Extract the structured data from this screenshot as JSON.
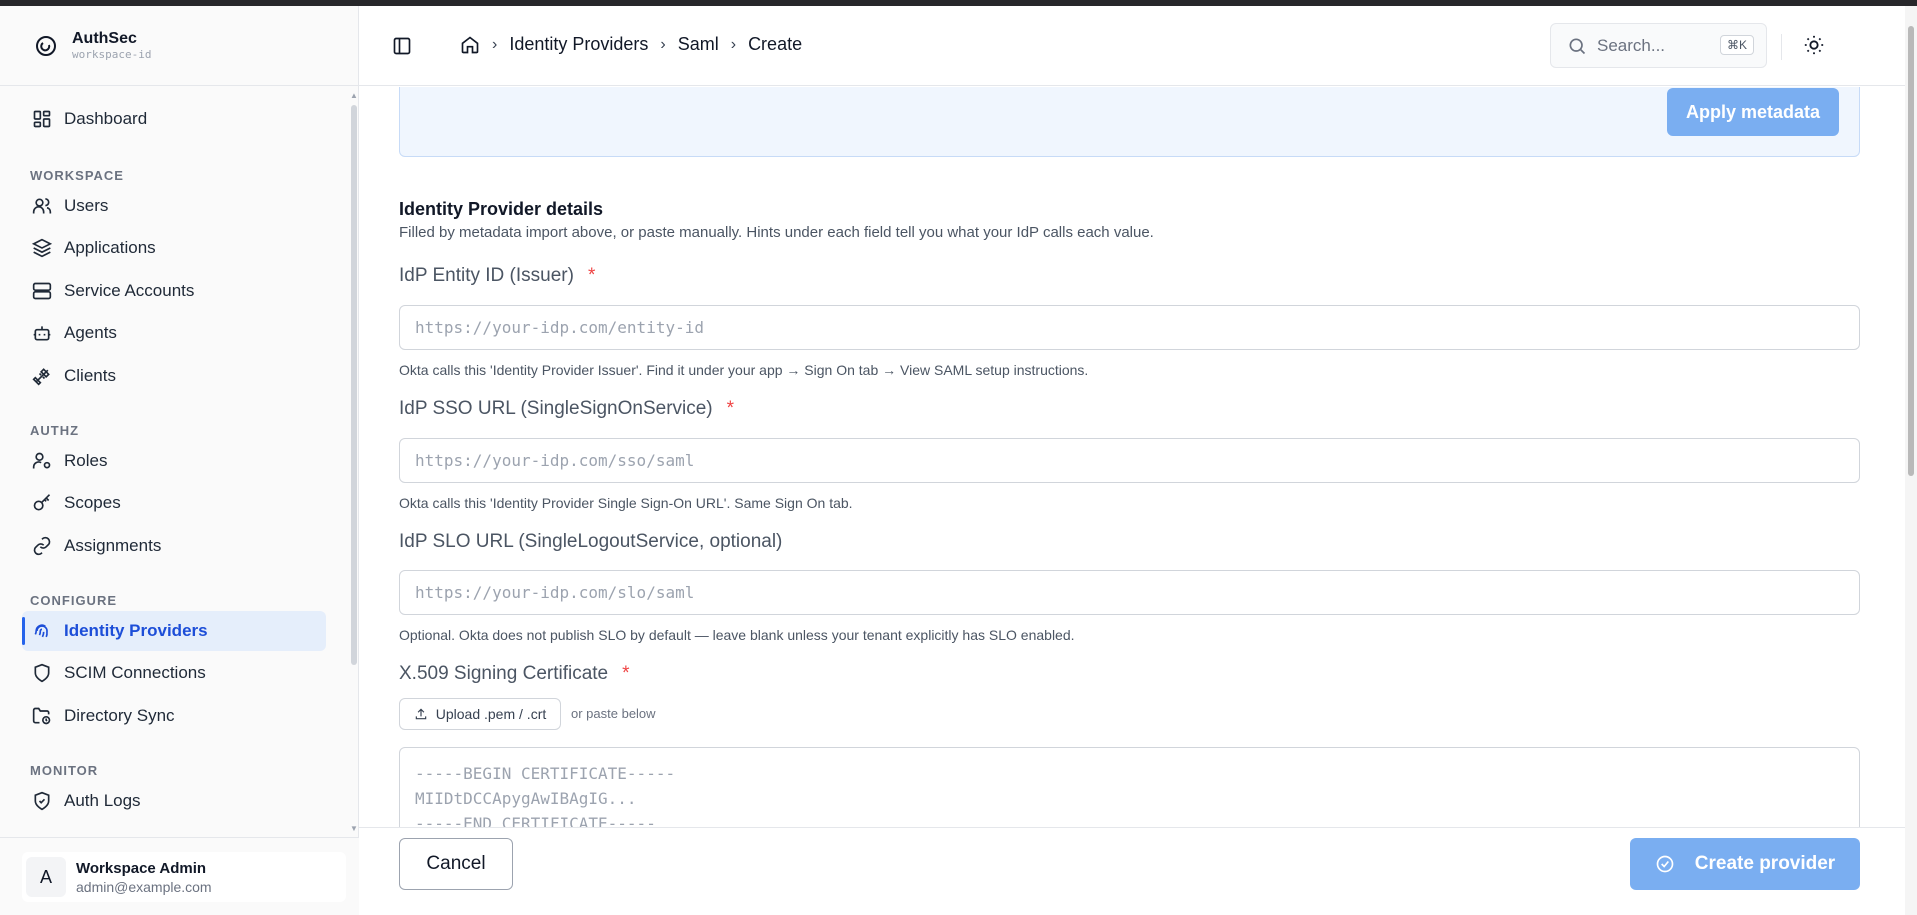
{
  "brand": {
    "name": "AuthSec",
    "workspace": "workspace-id"
  },
  "sidebar": {
    "top": [
      {
        "label": "Dashboard",
        "icon": "dashboard-icon"
      }
    ],
    "sections": [
      {
        "title": "WORKSPACE",
        "items": [
          {
            "label": "Users",
            "icon": "users-icon"
          },
          {
            "label": "Applications",
            "icon": "layers-icon"
          },
          {
            "label": "Service Accounts",
            "icon": "server-icon"
          },
          {
            "label": "Agents",
            "icon": "bot-icon"
          },
          {
            "label": "Clients",
            "icon": "plug-icon"
          }
        ]
      },
      {
        "title": "AUTHZ",
        "items": [
          {
            "label": "Roles",
            "icon": "user-cog-icon"
          },
          {
            "label": "Scopes",
            "icon": "key-icon"
          },
          {
            "label": "Assignments",
            "icon": "link-icon"
          }
        ]
      },
      {
        "title": "CONFIGURE",
        "items": [
          {
            "label": "Identity Providers",
            "icon": "fingerprint-icon",
            "active": true
          },
          {
            "label": "SCIM Connections",
            "icon": "shield-icon"
          },
          {
            "label": "Directory Sync",
            "icon": "folder-sync-icon"
          }
        ]
      },
      {
        "title": "MONITOR",
        "items": [
          {
            "label": "Auth Logs",
            "icon": "shield-check-icon"
          }
        ]
      }
    ]
  },
  "user": {
    "initial": "A",
    "name": "Workspace Admin",
    "email": "admin@example.com"
  },
  "header": {
    "breadcrumbs": [
      "Identity Providers",
      "Saml",
      "Create"
    ],
    "search_placeholder": "Search...",
    "search_shortcut": "⌘K"
  },
  "metadata": {
    "apply_label": "Apply metadata"
  },
  "idp_details": {
    "title": "Identity Provider details",
    "description": "Filled by metadata import above, or paste manually. Hints under each field tell you what your IdP calls each value.",
    "fields": [
      {
        "label": "IdP Entity ID (Issuer)",
        "required": "*",
        "placeholder": "https://your-idp.com/entity-id",
        "value": "",
        "hint": "Okta calls this 'Identity Provider Issuer'. Find it under your app → Sign On tab → View SAML setup instructions."
      },
      {
        "label": "IdP SSO URL (SingleSignOnService)",
        "required": "*",
        "placeholder": "https://your-idp.com/sso/saml",
        "value": "",
        "hint": "Okta calls this 'Identity Provider Single Sign-On URL'. Same Sign On tab."
      },
      {
        "label": "IdP SLO URL (SingleLogoutService, optional)",
        "required": "",
        "placeholder": "https://your-idp.com/slo/saml",
        "value": "",
        "hint": "Optional. Okta does not publish SLO by default — leave blank unless your tenant explicitly has SLO enabled."
      }
    ],
    "certificate": {
      "label": "X.509 Signing Certificate",
      "required": "*",
      "upload_label": "Upload .pem / .crt",
      "or_text": "or paste below",
      "placeholder": "-----BEGIN CERTIFICATE-----\nMIIDtDCCApygAwIBAgIG...\n-----END CERTIFICATE-----"
    }
  },
  "footer": {
    "cancel_label": "Cancel",
    "create_label": "Create provider"
  },
  "colors": {
    "accent": "#2563eb",
    "accent_disabled": "#7aaef1",
    "required": "#ef4444",
    "active_bg": "#e5eefb"
  }
}
